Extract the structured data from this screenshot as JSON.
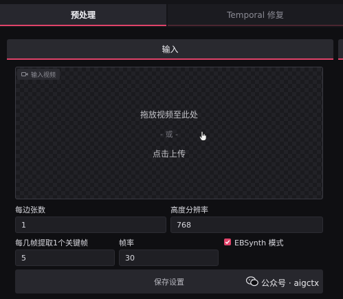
{
  "tabs": [
    {
      "label": "预处理",
      "active": true
    },
    {
      "label": "Temporal 修复",
      "active": false
    }
  ],
  "section": {
    "title": "输入"
  },
  "dropzone": {
    "label": "输入视频",
    "label_icon": "video-icon",
    "drop_text": "拖放视频至此处",
    "or_text": "- 或 -",
    "click_text": "点击上传"
  },
  "fields": {
    "per_side_label": "每边张数",
    "per_side_value": "1",
    "height_res_label": "高度分辨率",
    "height_res_value": "768",
    "keyframe_interval_label": "每几帧提取1个关键帧",
    "keyframe_interval_value": "5",
    "fps_label": "帧率",
    "fps_value": "30"
  },
  "ebsynth": {
    "label": "EBSynth 模式",
    "checked": true
  },
  "save_button": {
    "label": "保存设置"
  },
  "watermark": {
    "text": "公众号 · aigctx",
    "icon": "wechat-icon"
  },
  "colors": {
    "accent": "#e0436a",
    "background": "#0f0f12",
    "panel": "#27272e"
  }
}
